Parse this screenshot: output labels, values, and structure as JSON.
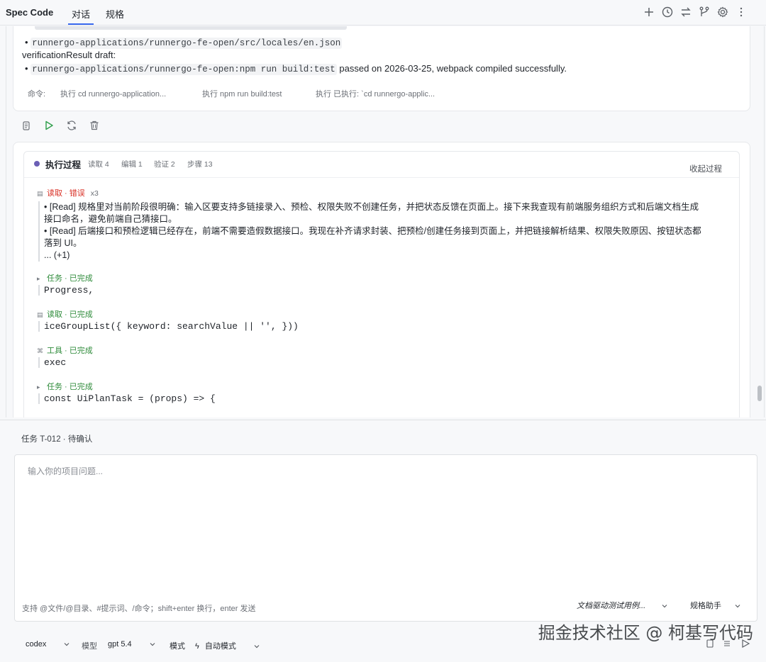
{
  "app": {
    "title": "Spec Code"
  },
  "tabs": [
    {
      "label": "对话"
    },
    {
      "label": "规格"
    }
  ],
  "toolbar": {
    "icons": [
      "plus-icon",
      "history-icon",
      "swap-icon",
      "branch-icon",
      "gear-icon",
      "more-icon"
    ]
  },
  "result_card": {
    "file_item": "runnergo-applications/runnergo-fe-open/src/locales/en.json",
    "verification_heading": "verificationResult draft:",
    "verification_code": "runnergo-applications/runnergo-fe-open:npm run build:test",
    "verification_text": "passed on 2026-03-25, webpack compiled successfully.",
    "commands_label": "命令:",
    "commands": [
      "执行 cd runnergo-application...",
      "执行 npm run build:test",
      "执行 已执行: `cd runnergo-applic..."
    ]
  },
  "actions": [
    "copy-icon",
    "run-icon",
    "refresh-icon",
    "delete-icon"
  ],
  "process": {
    "title": "执行过程",
    "stats": [
      "读取 4",
      "编辑 1",
      "验证 2",
      "步骤 13"
    ],
    "collapse_label": "收起过程",
    "steps": [
      {
        "label": "读取 · 错误",
        "count": "x3",
        "lines": [
          "• [Read] 规格里对当前阶段很明确：输入区要支持多链接录入、预检、权限失败不创建任务，并把状态反馈在页面上。接下来我查现有前端服务组织方式和后端文档生成",
          "接口命名，避免前端自己猜接口。",
          "• [Read] 后端接口和预检逻辑已经存在，前端不需要造假数据接口。我现在补齐请求封装、把预检/创建任务接到页面上，并把链接解析结果、权限失败原因、按钮状态都",
          "落到 UI。",
          "... (+1)"
        ]
      },
      {
        "label": "任务 · 已完成",
        "code": "Progress,"
      },
      {
        "label": "读取 · 已完成",
        "code": "iceGroupList({ keyword: searchValue || '', }))"
      },
      {
        "label": "工具 · 已完成",
        "code": "exec"
      },
      {
        "label": "任务 · 已完成",
        "code": "const UiPlanTask = (props) => {"
      }
    ]
  },
  "composer": {
    "task_status": "任务 T-012 · 待确认",
    "placeholder": "输入你的项目问题...",
    "hint": "支持 @文件/@目录、#提示词、/命令；shift+enter 换行，enter 发送",
    "template_select": "文档驱动测试用例...",
    "assistant_select": "规格助手",
    "agent": "codex",
    "model_label": "模型",
    "model": "gpt 5.4",
    "mode_label": "模式",
    "mode": "自动模式",
    "watermark": "掘金技术社区 @ 柯基写代码"
  },
  "colors": {
    "accent": "#3b6bf0",
    "error": "#d93026",
    "success": "#2e8b3a",
    "run_icon": "#2e9e4a"
  }
}
